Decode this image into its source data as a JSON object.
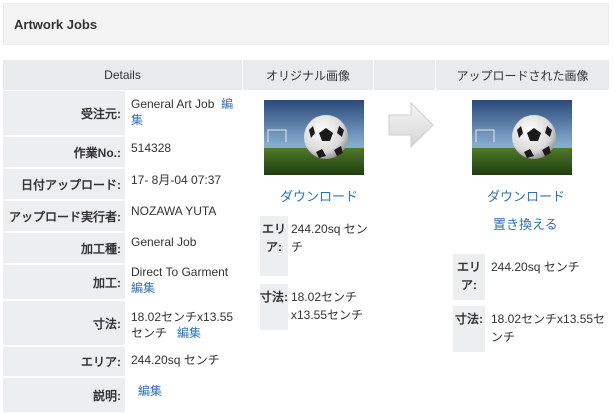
{
  "header": {
    "title": "Artwork Jobs"
  },
  "columns": {
    "details": "Details",
    "original": "オリジナル画像",
    "uploaded": "アップロードされた画像"
  },
  "details": {
    "order_label": "受注元:",
    "order_value": "General Art Job",
    "order_edit": "編集",
    "job_no_label": "作業No.:",
    "job_no_value": "514328",
    "upload_date_label": "日付アップロード:",
    "upload_date_value": "17- 8月-04 07:37",
    "uploader_label": "アップロード実行者:",
    "uploader_value": "NOZAWA YUTA",
    "process_type_label": "加工種:",
    "process_type_value": "General Job",
    "process_label": "加工:",
    "process_value": "Direct To Garment",
    "process_edit": "編集",
    "size_label": "寸法:",
    "size_value": "18.02センチx13.55センチ",
    "size_edit": "編集",
    "area_label": "エリア:",
    "area_value": "244.20sq センチ",
    "desc_label": "説明:",
    "desc_edit": "編集"
  },
  "original": {
    "download": "ダウンロード",
    "area_label": "エリア:",
    "area_value": "244.20sq センチ",
    "size_label": "寸法:",
    "size_value": "18.02センチx13.55センチ"
  },
  "uploaded": {
    "download": "ダウンロード",
    "replace": "置き換える",
    "area_label": "エリア:",
    "area_value": "244.20sq センチ",
    "size_label": "寸法:",
    "size_value": "18.02センチx13.55センチ"
  },
  "colors": {
    "link": "#3070b8",
    "label_bg": "#eceef0",
    "header_bg": "#e8eaeb"
  },
  "icons": {
    "arrow": "arrow-right-icon",
    "thumbnail": "soccer-ball-image"
  }
}
